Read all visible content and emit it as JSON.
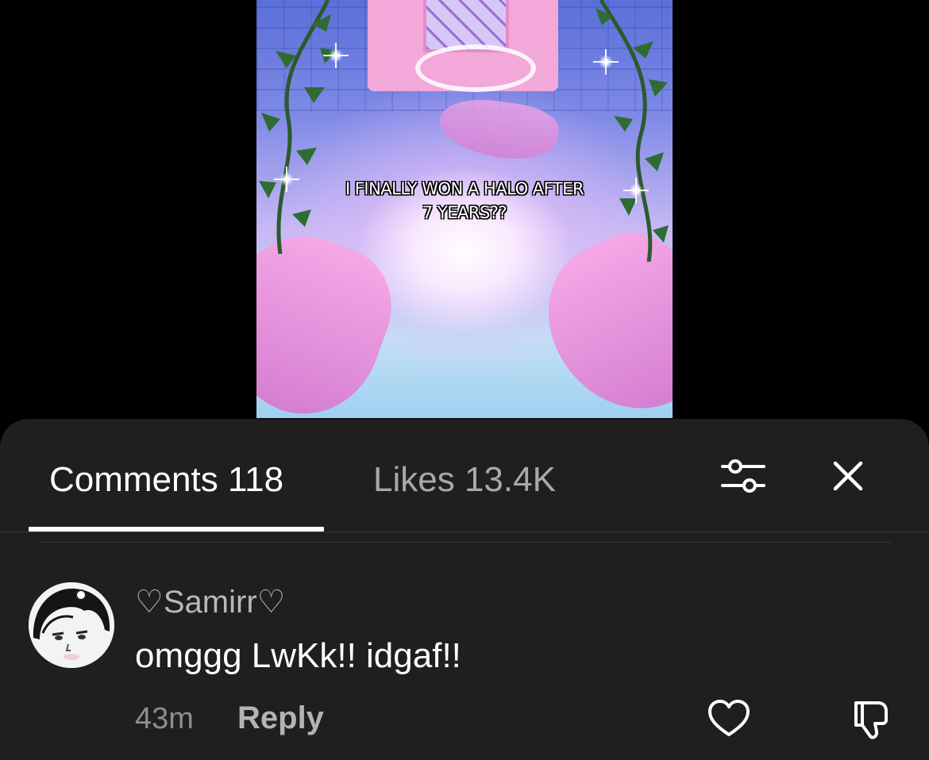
{
  "video": {
    "caption_line1": "I FINALLY WON A HALO AFTER",
    "caption_line2": "7 YEARS??"
  },
  "comments_panel": {
    "tabs": [
      {
        "label": "Comments 118",
        "active": true
      },
      {
        "label": "Likes 13.4K",
        "active": false
      }
    ],
    "icons": {
      "filter": "filter-sliders-icon",
      "close": "close-icon"
    },
    "comments": [
      {
        "username": "♡Samirr♡",
        "text": "omggg LwKk!! idgaf!!",
        "time": "43m",
        "reply_label": "Reply",
        "icons": {
          "like": "heart-outline-icon",
          "dislike": "thumbs-down-icon"
        }
      }
    ]
  },
  "colors": {
    "background": "#000000",
    "panel": "#1f1f1f",
    "active_tab": "#ffffff",
    "inactive_tab": "#a9a9a9",
    "muted_text": "#8e8e8e"
  }
}
